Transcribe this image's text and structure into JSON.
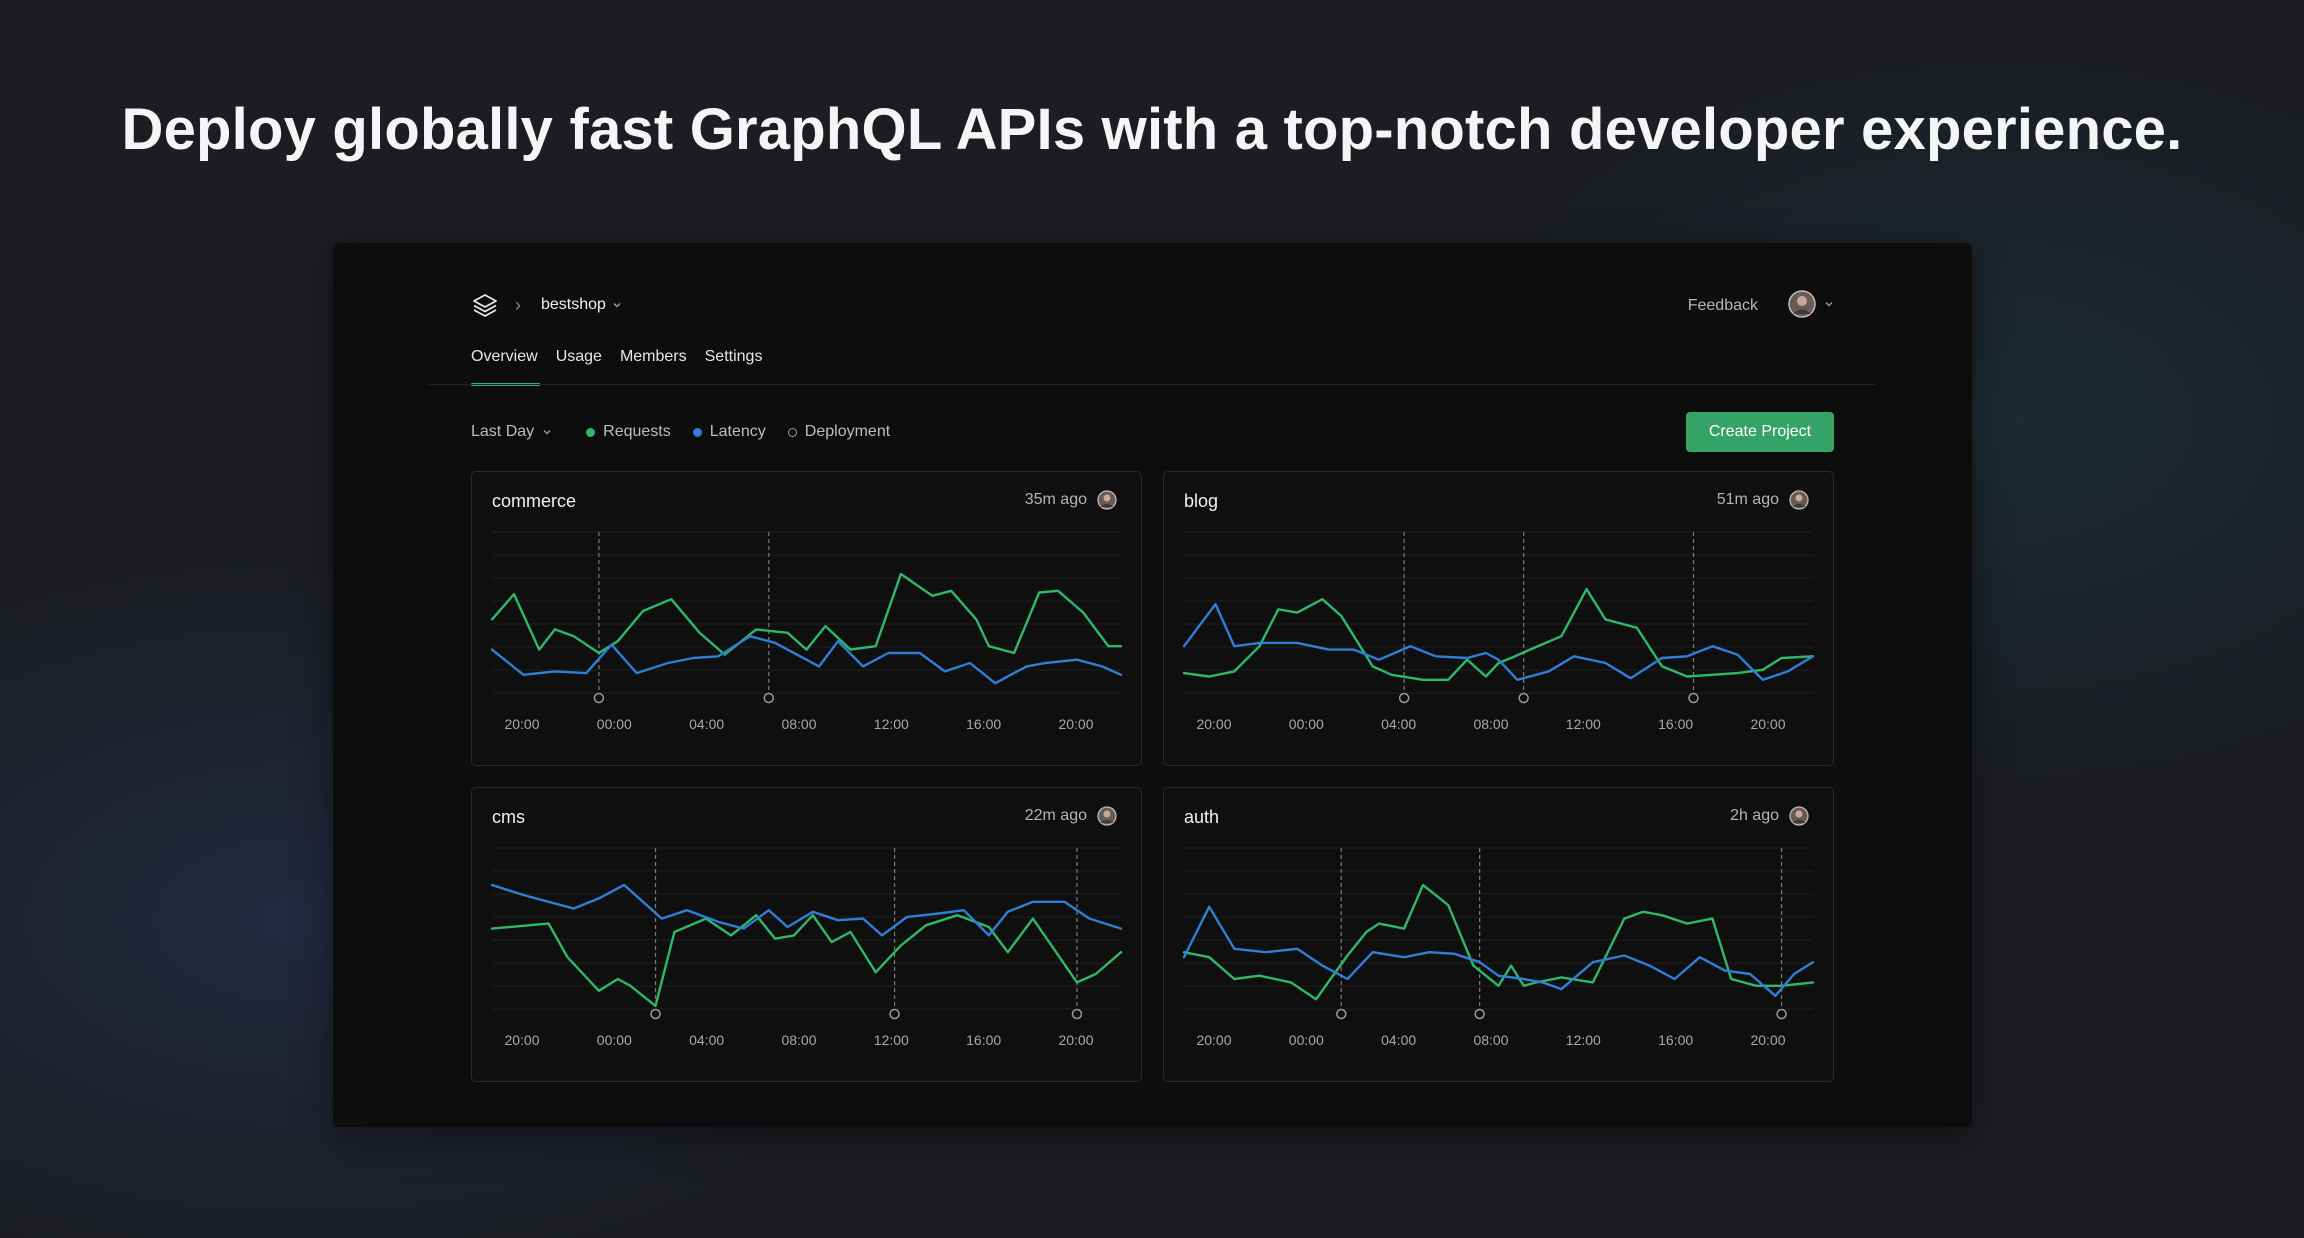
{
  "headline": "Deploy globally fast GraphQL APIs with a top-notch developer experience.",
  "topbar": {
    "logo_icon": "stack-layers-icon",
    "project": "bestshop",
    "feedback": "Feedback"
  },
  "tabs": [
    {
      "label": "Overview",
      "active": true
    },
    {
      "label": "Usage"
    },
    {
      "label": "Members"
    },
    {
      "label": "Settings"
    }
  ],
  "filters": {
    "range": "Last Day",
    "legend": {
      "requests": {
        "label": "Requests",
        "color": "#2fb86a"
      },
      "latency": {
        "label": "Latency",
        "color": "#2f7fd6"
      },
      "deployment": {
        "label": "Deployment"
      }
    }
  },
  "create_button": "Create Project",
  "colors": {
    "accent": "#35a266",
    "requests": "#2fb86a",
    "latency": "#2f7fd6"
  },
  "projects": [
    {
      "name": "commerce",
      "updated": "35m ago",
      "ticks": [
        "20:00",
        "00:00",
        "04:00",
        "08:00",
        "12:00",
        "16:00",
        "20:00"
      ]
    },
    {
      "name": "blog",
      "updated": "51m ago",
      "ticks": [
        "20:00",
        "00:00",
        "04:00",
        "08:00",
        "12:00",
        "16:00",
        "20:00"
      ]
    },
    {
      "name": "cms",
      "updated": "22m ago",
      "ticks": [
        "20:00",
        "00:00",
        "04:00",
        "08:00",
        "12:00",
        "16:00",
        "20:00"
      ]
    },
    {
      "name": "auth",
      "updated": "2h ago",
      "ticks": [
        "20:00",
        "00:00",
        "04:00",
        "08:00",
        "12:00",
        "16:00",
        "20:00"
      ]
    }
  ],
  "chart_data": [
    {
      "type": "line",
      "title": "commerce",
      "x_ticks": [
        "20:00",
        "00:00",
        "04:00",
        "08:00",
        "12:00",
        "16:00",
        "20:00"
      ],
      "deployments": [
        0.17,
        0.44
      ],
      "series": [
        {
          "name": "Requests",
          "x": [
            0,
            0.035,
            0.075,
            0.1,
            0.13,
            0.17,
            0.2,
            0.24,
            0.285,
            0.33,
            0.37,
            0.42,
            0.47,
            0.5,
            0.53,
            0.57,
            0.61,
            0.65,
            0.7,
            0.73,
            0.77,
            0.79,
            0.83,
            0.87,
            0.9,
            0.94,
            0.98,
            1.0
          ],
          "y": [
            0.48,
            0.63,
            0.3,
            0.42,
            0.38,
            0.28,
            0.35,
            0.53,
            0.6,
            0.4,
            0.27,
            0.42,
            0.4,
            0.3,
            0.44,
            0.3,
            0.32,
            0.75,
            0.62,
            0.65,
            0.48,
            0.32,
            0.28,
            0.64,
            0.65,
            0.52,
            0.32,
            0.32
          ]
        },
        {
          "name": "Latency",
          "x": [
            0,
            0.05,
            0.1,
            0.15,
            0.19,
            0.23,
            0.28,
            0.32,
            0.36,
            0.41,
            0.45,
            0.49,
            0.52,
            0.55,
            0.59,
            0.63,
            0.68,
            0.72,
            0.76,
            0.8,
            0.85,
            0.88,
            0.93,
            0.97,
            1.0
          ],
          "y": [
            0.3,
            0.15,
            0.17,
            0.16,
            0.33,
            0.16,
            0.22,
            0.25,
            0.26,
            0.38,
            0.34,
            0.26,
            0.2,
            0.35,
            0.2,
            0.28,
            0.28,
            0.17,
            0.22,
            0.1,
            0.2,
            0.22,
            0.24,
            0.2,
            0.15
          ]
        }
      ]
    },
    {
      "type": "line",
      "title": "blog",
      "x_ticks": [
        "20:00",
        "00:00",
        "04:00",
        "08:00",
        "12:00",
        "16:00",
        "20:00"
      ],
      "deployments": [
        0.35,
        0.54,
        0.81
      ],
      "series": [
        {
          "name": "Requests",
          "x": [
            0,
            0.04,
            0.08,
            0.12,
            0.15,
            0.18,
            0.22,
            0.25,
            0.3,
            0.33,
            0.38,
            0.42,
            0.45,
            0.48,
            0.5,
            0.52,
            0.55,
            0.6,
            0.64,
            0.67,
            0.72,
            0.76,
            0.8,
            0.84,
            0.88,
            0.92,
            0.95,
            1.0
          ],
          "y": [
            0.16,
            0.14,
            0.17,
            0.32,
            0.54,
            0.52,
            0.6,
            0.5,
            0.2,
            0.15,
            0.12,
            0.12,
            0.24,
            0.14,
            0.22,
            0.25,
            0.3,
            0.38,
            0.66,
            0.48,
            0.43,
            0.2,
            0.14,
            0.15,
            0.16,
            0.18,
            0.25,
            0.26
          ]
        },
        {
          "name": "Latency",
          "x": [
            0,
            0.05,
            0.08,
            0.12,
            0.18,
            0.23,
            0.27,
            0.31,
            0.36,
            0.4,
            0.45,
            0.48,
            0.5,
            0.53,
            0.58,
            0.62,
            0.67,
            0.71,
            0.76,
            0.8,
            0.84,
            0.88,
            0.92,
            0.96,
            1.0
          ],
          "y": [
            0.32,
            0.57,
            0.32,
            0.34,
            0.34,
            0.3,
            0.3,
            0.24,
            0.32,
            0.26,
            0.25,
            0.28,
            0.24,
            0.12,
            0.17,
            0.26,
            0.22,
            0.13,
            0.25,
            0.26,
            0.32,
            0.27,
            0.12,
            0.17,
            0.26
          ]
        }
      ]
    },
    {
      "type": "line",
      "title": "cms",
      "x_ticks": [
        "20:00",
        "00:00",
        "04:00",
        "08:00",
        "12:00",
        "16:00",
        "20:00"
      ],
      "deployments": [
        0.26,
        0.64,
        0.93
      ],
      "series": [
        {
          "name": "Requests",
          "x": [
            0,
            0.09,
            0.12,
            0.17,
            0.2,
            0.22,
            0.26,
            0.29,
            0.34,
            0.38,
            0.42,
            0.45,
            0.48,
            0.51,
            0.54,
            0.57,
            0.61,
            0.65,
            0.69,
            0.74,
            0.79,
            0.82,
            0.86,
            0.93,
            0.96,
            1.0
          ],
          "y": [
            0.52,
            0.55,
            0.35,
            0.15,
            0.22,
            0.18,
            0.06,
            0.5,
            0.58,
            0.48,
            0.6,
            0.46,
            0.48,
            0.6,
            0.44,
            0.5,
            0.26,
            0.42,
            0.54,
            0.6,
            0.53,
            0.38,
            0.58,
            0.2,
            0.25,
            0.38
          ]
        },
        {
          "name": "Latency",
          "x": [
            0,
            0.05,
            0.09,
            0.13,
            0.17,
            0.21,
            0.24,
            0.27,
            0.31,
            0.36,
            0.4,
            0.44,
            0.47,
            0.51,
            0.55,
            0.59,
            0.62,
            0.66,
            0.71,
            0.75,
            0.79,
            0.82,
            0.86,
            0.91,
            0.95,
            1.0
          ],
          "y": [
            0.78,
            0.72,
            0.68,
            0.64,
            0.7,
            0.78,
            0.68,
            0.58,
            0.63,
            0.56,
            0.52,
            0.63,
            0.53,
            0.62,
            0.57,
            0.58,
            0.48,
            0.59,
            0.61,
            0.63,
            0.48,
            0.62,
            0.68,
            0.68,
            0.58,
            0.52
          ]
        }
      ]
    },
    {
      "type": "line",
      "title": "auth",
      "x_ticks": [
        "20:00",
        "00:00",
        "04:00",
        "08:00",
        "12:00",
        "16:00",
        "20:00"
      ],
      "deployments": [
        0.25,
        0.47,
        0.95
      ],
      "series": [
        {
          "name": "Requests",
          "x": [
            0,
            0.04,
            0.08,
            0.12,
            0.17,
            0.21,
            0.26,
            0.29,
            0.31,
            0.35,
            0.38,
            0.42,
            0.46,
            0.5,
            0.52,
            0.54,
            0.56,
            0.6,
            0.65,
            0.7,
            0.73,
            0.76,
            0.8,
            0.84,
            0.87,
            0.91,
            0.95,
            1.0
          ],
          "y": [
            0.38,
            0.35,
            0.22,
            0.24,
            0.2,
            0.1,
            0.36,
            0.5,
            0.55,
            0.52,
            0.78,
            0.66,
            0.3,
            0.18,
            0.3,
            0.18,
            0.2,
            0.23,
            0.2,
            0.58,
            0.62,
            0.6,
            0.55,
            0.58,
            0.22,
            0.18,
            0.18,
            0.2
          ]
        },
        {
          "name": "Latency",
          "x": [
            0,
            0.04,
            0.08,
            0.13,
            0.18,
            0.22,
            0.26,
            0.3,
            0.35,
            0.39,
            0.43,
            0.47,
            0.5,
            0.54,
            0.57,
            0.6,
            0.65,
            0.7,
            0.74,
            0.78,
            0.82,
            0.86,
            0.9,
            0.94,
            0.97,
            1.0
          ],
          "y": [
            0.35,
            0.65,
            0.4,
            0.38,
            0.4,
            0.3,
            0.22,
            0.38,
            0.35,
            0.38,
            0.37,
            0.32,
            0.24,
            0.22,
            0.2,
            0.16,
            0.32,
            0.36,
            0.3,
            0.22,
            0.35,
            0.27,
            0.25,
            0.12,
            0.25,
            0.32
          ]
        }
      ]
    }
  ]
}
